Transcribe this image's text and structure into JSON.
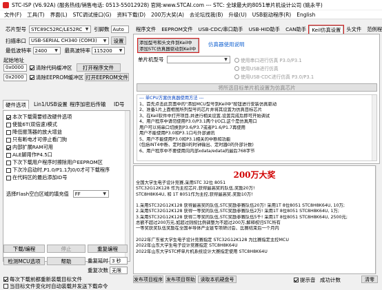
{
  "title": "STC-ISP (V6.92A) (服务热线/销售电话: 0513-55012928) 官网:www.STCAI.com  --- STC: 全球最大的8051单片机设计公司 (姚永平)",
  "menu": [
    "文件(F)",
    "工具(T)",
    "界面(L)",
    "STC调试接口(G)",
    "资料下载(D)",
    "200万大奖(A)",
    "去论坛找我(B)",
    "升级(U)",
    "USB驱动程序(R)",
    "English"
  ],
  "left": {
    "chip_label": "芯片型号",
    "chip_value": "STC89C52RC/LE52RC",
    "pins_label": "引脚数",
    "pins_value": "Auto",
    "port_label": "扫描串口",
    "port_value": "USB-SERIAL CH340 (COM3)",
    "settings": "设置",
    "min_baud_label": "最低波特率",
    "min_baud": "2400",
    "max_baud_label": "最高波特率",
    "max_baud": "115200",
    "start_addr_label": "起始地址",
    "addr1": "0x0000",
    "clr_code": "清除代码缓冲区",
    "open_prog": "打开程序文件",
    "addr2": "0x2000",
    "clr_eeprom": "清除EEPROM缓冲区",
    "open_eeprom": "打开EEPROM文件",
    "hw_tabs": [
      "硬件选项",
      "Lin1/USB设置",
      "程序加密后传输",
      "ID号"
    ],
    "options": [
      {
        "label": "本次下载需要修改硬件选项",
        "on": true
      },
      {
        "label": "使能6T(双倍速)模式",
        "on": false
      },
      {
        "label": "降低振荡器的放大增益",
        "on": false
      },
      {
        "label": "只有断电才可停止看门狗",
        "on": false
      },
      {
        "label": "内部扩展RAM可用",
        "on": true
      },
      {
        "label": "ALE脚用作P4.5口",
        "on": false
      },
      {
        "label": "下次下载用户程序时擦除用户EEPROM区",
        "on": false
      },
      {
        "label": "下次冷启动时,P1.0/P1.1为0/0才可下载程序",
        "on": false
      },
      {
        "label": "在代码区的最后添加ID号",
        "on": false
      }
    ],
    "flash_fill_label": "选择Flash空白区域的填充值",
    "flash_fill": "FF",
    "download": "下载/编程",
    "stop": "停止",
    "reprog": "重复编程",
    "detect_mcu": "检测MCU选项",
    "help": "帮助",
    "repeat_delay_label": "重复延时",
    "repeat_delay": "3 秒",
    "repeat_count_label": "重复次数",
    "repeat_count": "无限",
    "reload_label": "每次下载前都重新装载目标文件",
    "auto_dl_label": "当目标文件变化时自动装载并发送下载命令"
  },
  "tabs": [
    "程序文件",
    "EEPROM文件",
    "USB-CDC/串口助手",
    "USB-HID助手",
    "CAN助手",
    "Keil仿真设置",
    "头文件",
    "范例程序",
    "I"
  ],
  "sim": {
    "add_btn_line1": "添加型号和头文件到Keil中",
    "add_btn_line2": "添加STC仿真器驱动到Keil中",
    "sim_link": "仿真器使用说明",
    "mcu_label": "单片机型号",
    "rd1": "使用串口进行仿真  P3.0/P3.1",
    "rd2": "使用USB进行仿真",
    "rd3": "使用USB-CDC进行仿真  P3.0/P3.1",
    "set_btn": "将所选目标单片机设置为仿真芯片",
    "notes_head": "--- 单CPU方案仿真器使用方法 ---",
    "notes": [
      "1、首先点击此页面中的\"添加MCU型号到Keil中\"按钮进行安装仿真驱动",
      "2、准备1片上面框图所列型号的芯片并将其设置为仿真目标芯片",
      "3、在Keil软件中打开项目,并进行相关设置,设置完成后即可开始调试",
      "4、用户程序中请勿使用P3.0/P3.1两个I/O口,这个是仿真用口",
      "   用户可以将串口切换到P3.6/P3.7或者P1.6/P1.7再使用",
      "   用户不能使用P3.0和P3.1口与外部通讯",
      "5、用户不能使用P3.0和P3.1相关的中断和功能",
      "   (包括INT4中断、定时器0的时钟输出、定时器0的外部计数)",
      "6、用户程序中不要使用向内部xdata/edata的最后768字节"
    ]
  },
  "ad": {
    "title": "200万大奖",
    "lines": [
      "全国大学生电子设计竞赛,采用STC 32位 8051",
      "STC32G12K128 作为主控芯片,获得最高奖的队伍,奖励20万!",
      "STC8H8K64U, 和 1T 8051作为主控,获得最高奖,奖励10万!",
      "",
      "1.采用STC32G12K128 获得最高奖的队伍,STC奖励参赛队伍20万! 采用1T 8位8051 STC8H8K64U, 10万;",
      "2.采用STC32G12K128 获得一等奖的队伍,STC奖励参赛队伍2万! 采用1T 8位8051 STC8H8K64U, 1万;",
      "3.采用STC32G12K128 获得二等奖的队伍,STC奖励参赛队伍5千! 采用1T 8位8051 STC8H8K64U, 2500元;",
      "总额不超过200万元,如超过则按比例调整为不超过200万,解释权归STC所有",
      "一等奖获奖队伍奖励在全国半导体产业链专项研讨会、比赛结束后一个月内",
      "",
      "2022年广东省大学生电子设计竞赛指定 STC32G12K128 为比赛指定主控MCU",
      "2022年山东大学生电子设计竞赛指定 STC8H8K64U",
      "2022年山东大学STC杯单片机系统设计大赛指定使用 STC8H8K64U"
    ]
  },
  "bottom": {
    "send_file": "发布项目程序",
    "send_help": "发布项目帮助",
    "read_id": "读取本机硬盘号",
    "hint_label": "提示音",
    "scroll_label": "成功计数",
    "clear_btn": "清零"
  }
}
